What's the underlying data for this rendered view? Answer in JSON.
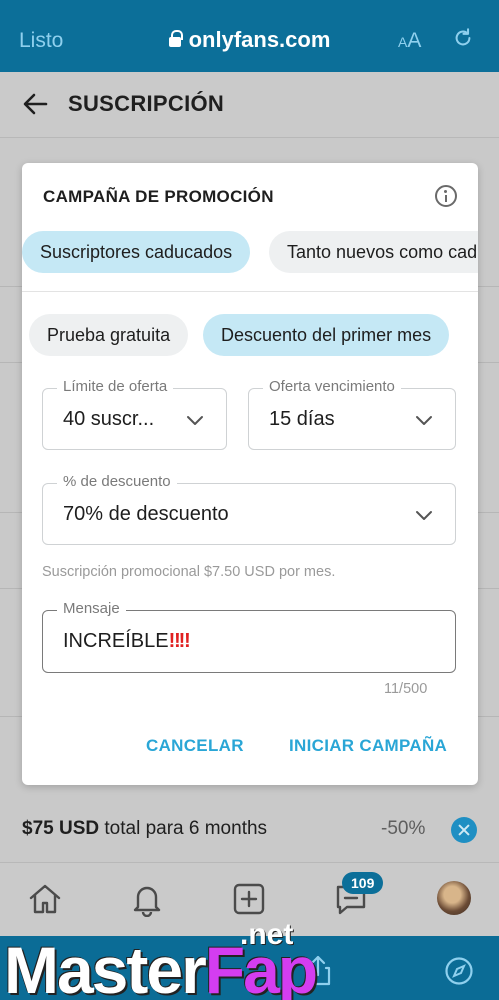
{
  "browser": {
    "done_label": "Listo",
    "url": "onlyfans.com",
    "text_size_small": "A",
    "text_size_large": "A"
  },
  "page": {
    "title": "SUSCRIPCIÓN"
  },
  "modal": {
    "title": "CAMPAÑA DE PROMOCIÓN",
    "audience_tabs": [
      {
        "label": "Suscriptores caducados",
        "active": true
      },
      {
        "label": "Tanto nuevos como caducados",
        "active": false
      }
    ],
    "type_tabs": [
      {
        "label": "Prueba gratuita",
        "active": false
      },
      {
        "label": "Descuento del primer mes",
        "active": true
      }
    ],
    "offer_limit": {
      "label": "Límite de oferta",
      "value": "40 suscr..."
    },
    "offer_expiry": {
      "label": "Oferta vencimiento",
      "value": "15 días"
    },
    "discount": {
      "label": "% de descuento",
      "value": "70% de descuento"
    },
    "helper_text": "Suscripción promocional $7.50 USD por mes.",
    "message": {
      "label": "Mensaje",
      "value": "INCREÍBLE",
      "emoji": "‼‼",
      "counter": "11/500"
    },
    "cancel_label": "CANCELAR",
    "start_label": "INICIAR CAMPAÑA"
  },
  "bundle_row": {
    "price": "$75 USD",
    "rest": " total para 6 months",
    "discount": "-50%"
  },
  "tabbar": {
    "badge": "109"
  },
  "watermark": {
    "master": "Master",
    "fap": "Fap",
    "net": ".net"
  },
  "colors": {
    "brand": "#0c6f99",
    "accent": "#2aa6d6",
    "chip_active": "#c5e8f5"
  }
}
